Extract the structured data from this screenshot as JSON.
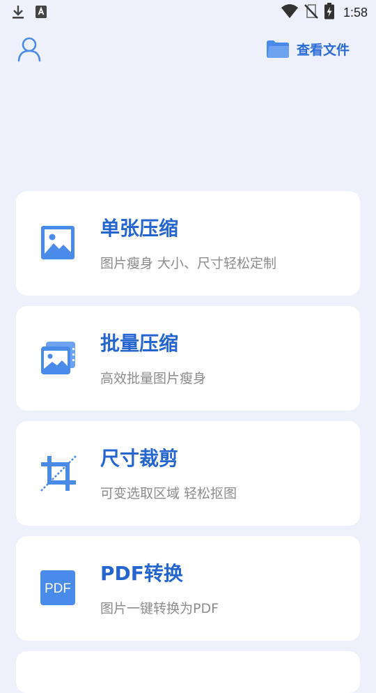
{
  "status_bar": {
    "time": "1:58",
    "icons": [
      "download-icon",
      "keyboard-a-icon",
      "wifi-icon",
      "no-sim-icon",
      "battery-charging-icon"
    ]
  },
  "header": {
    "view_files_label": "查看文件",
    "icons": [
      "user-icon",
      "folder-icon"
    ]
  },
  "colors": {
    "accent": "#2565d0",
    "icon_blue": "#4a8ae8",
    "background": "#eef0fb",
    "card": "#ffffff",
    "subtitle": "#8c8c8c"
  },
  "cards": [
    {
      "title": "单张压缩",
      "subtitle": "图片瘦身 大小、尺寸轻松定制",
      "icon": "image-icon"
    },
    {
      "title": "批量压缩",
      "subtitle": "高效批量图片瘦身",
      "icon": "batch-images-icon"
    },
    {
      "title": "尺寸裁剪",
      "subtitle": "可变选取区域 轻松抠图",
      "icon": "crop-icon"
    },
    {
      "title": "PDF转换",
      "subtitle": "图片一键转换为PDF",
      "icon": "pdf-icon",
      "icon_text": "PDF"
    }
  ]
}
